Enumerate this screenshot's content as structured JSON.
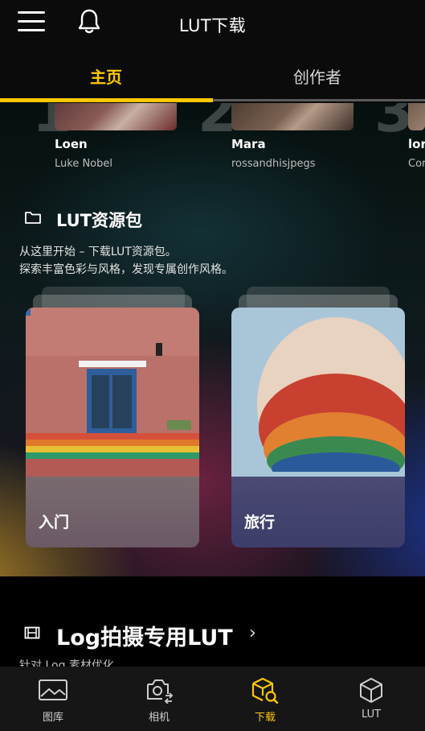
{
  "header": {
    "title": "LUT下载"
  },
  "tabs": [
    {
      "label": "主页",
      "active": true
    },
    {
      "label": "创作者",
      "active": false
    }
  ],
  "creators": [
    {
      "name": "Loen",
      "handle": "Luke Nobel"
    },
    {
      "name": "Mara",
      "handle": "rossandhisjpegs"
    },
    {
      "name": "lor",
      "handle": "Cor"
    }
  ],
  "lut_section": {
    "title": "LUT资源包",
    "desc_line1": "从这里开始 – 下载LUT资源包。",
    "desc_line2": "探索丰富色彩与风格，发现专属创作风格。",
    "cards": [
      {
        "label": "入门"
      },
      {
        "label": "旅行"
      }
    ]
  },
  "log_section": {
    "title": "Log拍摄专用LUT",
    "subtitle": "针对 Log 素材优化"
  },
  "bottom_nav": [
    {
      "label": "图库",
      "icon": "gallery-icon"
    },
    {
      "label": "相机",
      "icon": "camera-switch-icon"
    },
    {
      "label": "下载",
      "icon": "download-cube-icon",
      "active": true
    },
    {
      "label": "LUT",
      "icon": "cube-icon"
    }
  ],
  "colors": {
    "accent": "#FFC800",
    "background": "#000000"
  }
}
